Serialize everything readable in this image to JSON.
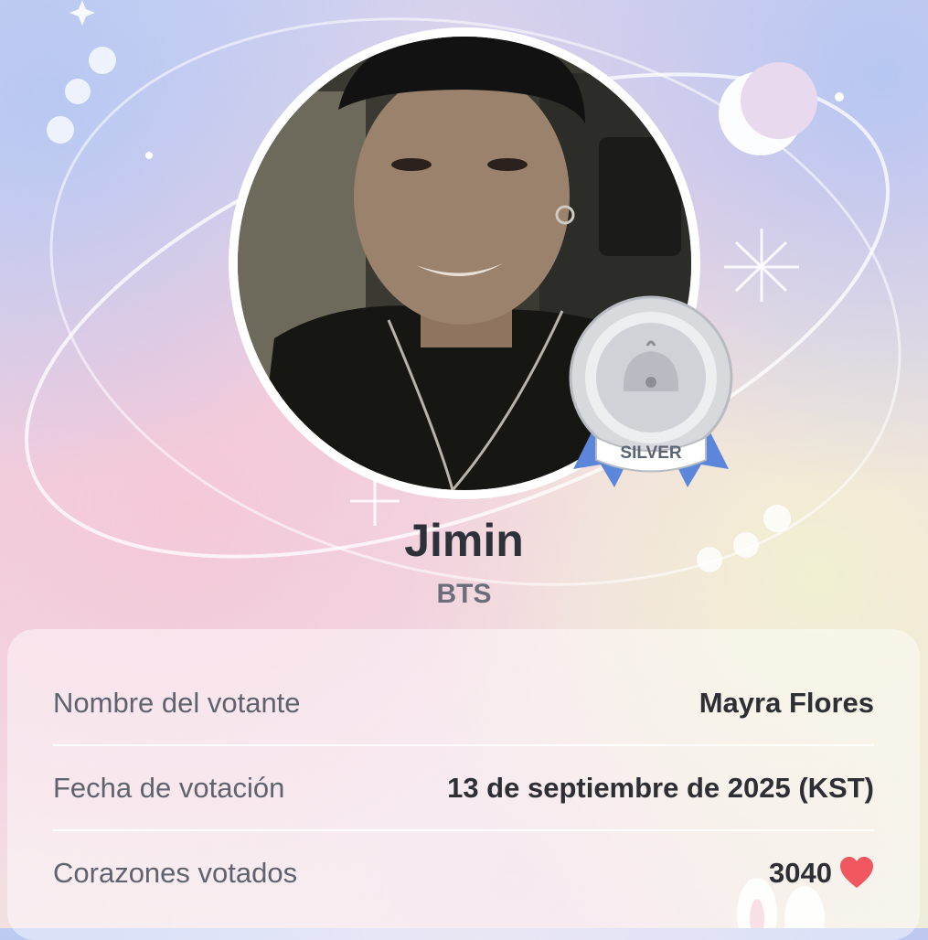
{
  "idol": {
    "name": "Jimin",
    "group": "BTS",
    "badge": "SILVER"
  },
  "vote_info": {
    "rows": [
      {
        "label": "Nombre del votante",
        "value": "Mayra Flores"
      },
      {
        "label": "Fecha de votación",
        "value": "13 de septiembre de 2025 (KST)"
      },
      {
        "label": "Corazones votados",
        "value": "3040"
      }
    ]
  },
  "icons": {
    "heart": "heart-icon",
    "moon": "crescent-moon-icon",
    "badge": "silver-medal-icon"
  },
  "colors": {
    "heart": "#f0575f",
    "badge_ribbon": "#5b86d9",
    "badge_silver": "#c9ccd1"
  }
}
